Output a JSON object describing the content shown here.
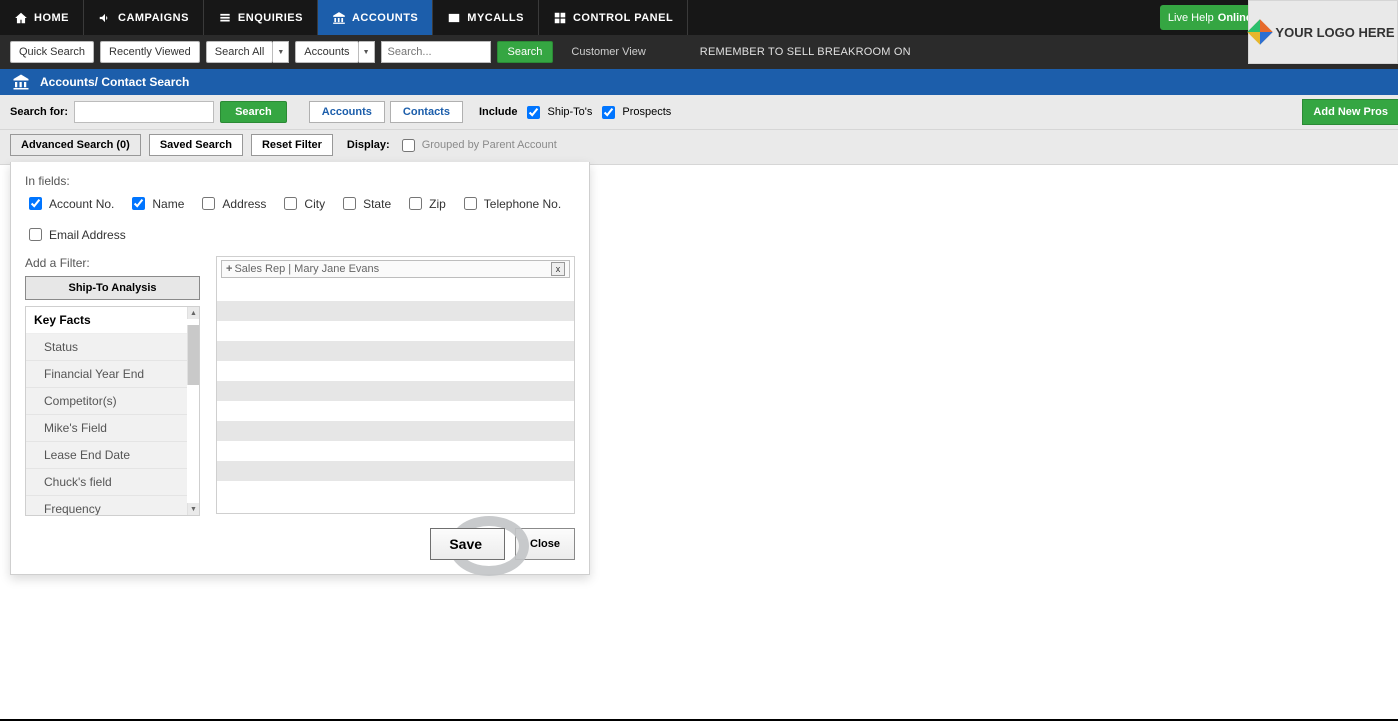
{
  "nav": {
    "items": [
      {
        "label": "HOME",
        "icon": "home"
      },
      {
        "label": "CAMPAIGNS",
        "icon": "bullhorn"
      },
      {
        "label": "ENQUIRIES",
        "icon": "list"
      },
      {
        "label": "ACCOUNTS",
        "icon": "bank",
        "active": true
      },
      {
        "label": "MYCALLS",
        "icon": "id"
      },
      {
        "label": "CONTROL PANEL",
        "icon": "grid"
      }
    ],
    "live_help": "Live Help",
    "online": "Online"
  },
  "toolbar": {
    "quick_search": "Quick Search",
    "recently_viewed": "Recently Viewed",
    "search_all": "Search All",
    "accounts": "Accounts",
    "search_placeholder": "Search...",
    "search_btn": "Search",
    "customer_view": "Customer View",
    "marquee": "REMEMBER TO SELL BREAKROOM ON"
  },
  "logo_text": "YOUR LOGO HERE",
  "page_title": "Accounts/ Contact Search",
  "search_strip": {
    "search_for_label": "Search for:",
    "search_btn": "Search",
    "accounts_tab": "Accounts",
    "contacts_tab": "Contacts",
    "include_label": "Include",
    "shipTos_label": "Ship-To's",
    "prospects_label": "Prospects",
    "add_prospect": "Add New Pros"
  },
  "search_sub": {
    "advanced": "Advanced Search (0)",
    "saved": "Saved Search",
    "reset": "Reset Filter",
    "display_label": "Display:",
    "grouped_label": "Grouped by Parent Account"
  },
  "advanced_panel": {
    "in_fields_label": "In fields:",
    "fields": [
      {
        "label": "Account No.",
        "checked": true
      },
      {
        "label": "Name",
        "checked": true
      },
      {
        "label": "Address",
        "checked": false
      },
      {
        "label": "City",
        "checked": false
      },
      {
        "label": "State",
        "checked": false
      },
      {
        "label": "Zip",
        "checked": false
      },
      {
        "label": "Telephone No.",
        "checked": false
      },
      {
        "label": "Email Address",
        "checked": false
      }
    ],
    "add_filter_label": "Add a Filter:",
    "shipto_analysis": "Ship-To Analysis",
    "group_header": "Key Facts",
    "filter_items": [
      "Status",
      "Financial Year End",
      "Competitor(s)",
      "Mike's Field",
      "Lease End Date",
      "Chuck's field",
      "Frequency"
    ],
    "chip_label": "Sales Rep | Mary Jane Evans",
    "chip_x": "x",
    "chip_plus": "+",
    "save_btn": "Save",
    "close_btn": "Close"
  }
}
